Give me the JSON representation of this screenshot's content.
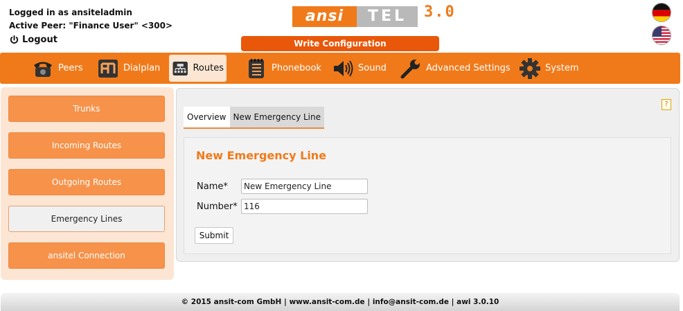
{
  "header": {
    "logged_in": "Logged in as ansiteladmin",
    "active_peer": "Active Peer: \"Finance User\" <300>",
    "logout": "Logout",
    "write_config": "Write Configuration",
    "logo": {
      "part1": "ansi",
      "part2": "TEL",
      "version": "3.0"
    },
    "flags": [
      "german-flag",
      "us-flag"
    ]
  },
  "nav": {
    "items": [
      {
        "label": "Peers",
        "icon": "phone-icon"
      },
      {
        "label": "Dialplan",
        "icon": "dialplan-icon"
      },
      {
        "label": "Routes",
        "icon": "routes-icon",
        "active": true
      },
      {
        "label": "Phonebook",
        "icon": "phonebook-icon"
      },
      {
        "label": "Sound",
        "icon": "speaker-icon"
      },
      {
        "label": "Advanced Settings",
        "icon": "wrench-icon"
      },
      {
        "label": "System",
        "icon": "gear-icon"
      }
    ]
  },
  "sidebar": {
    "items": [
      {
        "label": "Trunks"
      },
      {
        "label": "Incoming Routes"
      },
      {
        "label": "Outgoing Routes"
      },
      {
        "label": "Emergency Lines",
        "active": true
      },
      {
        "label": "ansitel Connection"
      }
    ]
  },
  "main": {
    "help": "?",
    "tabs": [
      {
        "label": "Overview"
      },
      {
        "label": "New Emergency Line"
      }
    ],
    "form_title": "New Emergency Line",
    "fields": [
      {
        "label": "Name*",
        "value": "New Emergency Line"
      },
      {
        "label": "Number*",
        "value": "116"
      }
    ],
    "submit": "Submit"
  },
  "footer": "© 2015 ansit-com GmbH | www.ansit-com.de | info@ansit-com.de | awi 3.0.10",
  "colors": {
    "accent": "#f07a1a",
    "write_button": "#e8570a",
    "sidebar_bg": "#fde5d3"
  }
}
